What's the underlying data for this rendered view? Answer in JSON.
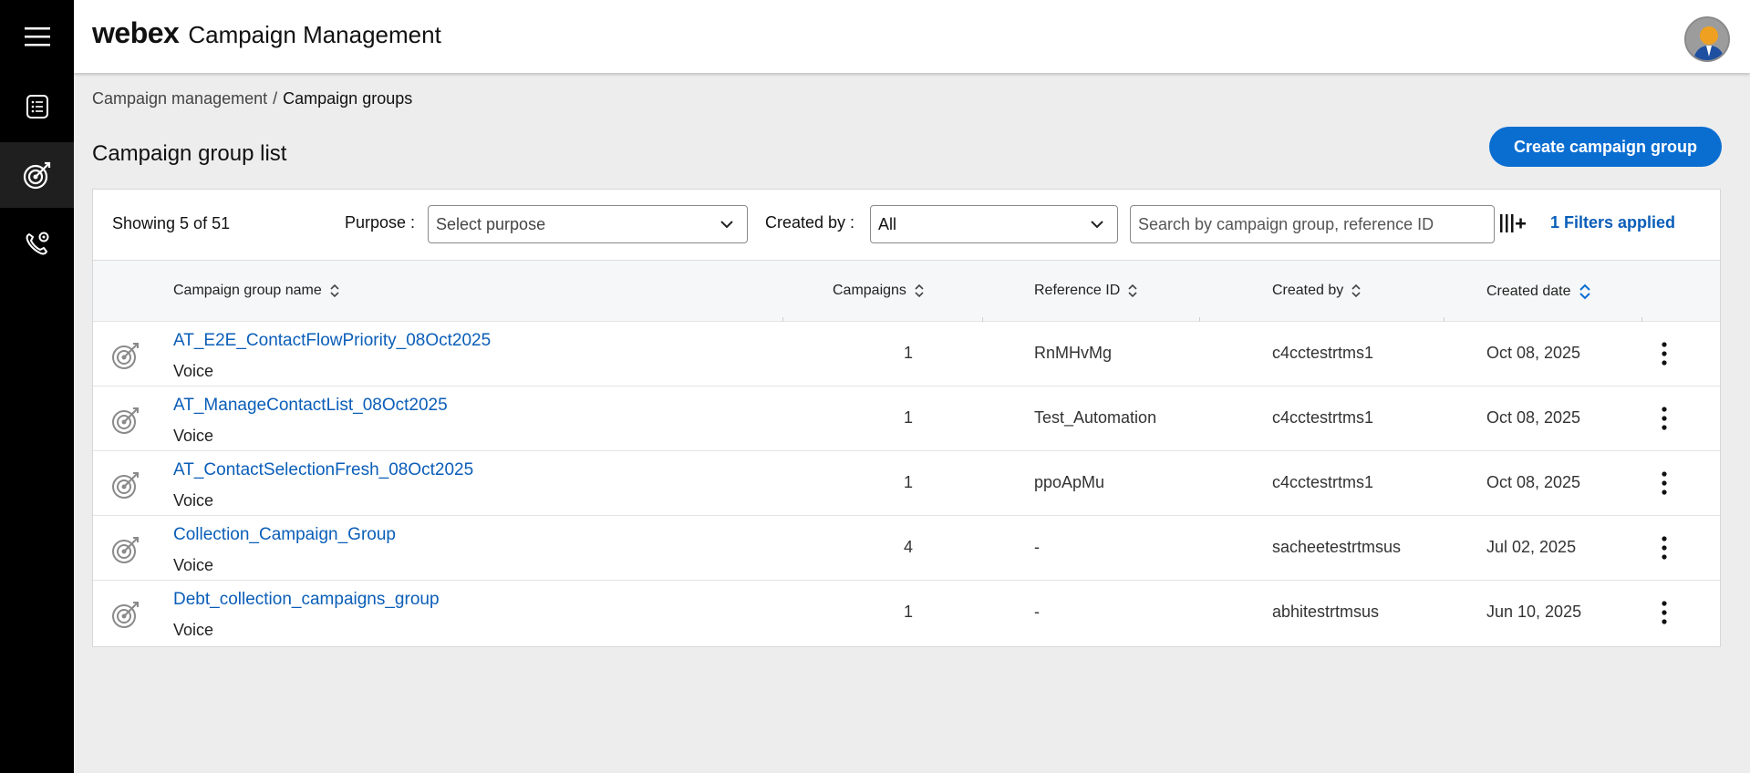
{
  "header": {
    "logo": "webex",
    "title": "Campaign Management"
  },
  "breadcrumb": {
    "parent": "Campaign management",
    "separator": "/",
    "current": "Campaign groups"
  },
  "page": {
    "title": "Campaign group list",
    "create_label": "Create campaign group"
  },
  "toolbar": {
    "showing": "Showing 5 of 51",
    "purpose_label": "Purpose :",
    "purpose_value": "Select purpose",
    "created_by_label": "Created by :",
    "created_by_value": "All",
    "search_placeholder": "Search by campaign group, reference ID",
    "filters_applied": "1 Filters applied"
  },
  "table": {
    "columns": {
      "name": "Campaign group name",
      "campaigns": "Campaigns",
      "reference": "Reference ID",
      "created_by": "Created by",
      "created_date": "Created date"
    },
    "rows": [
      {
        "name": "AT_E2E_ContactFlowPriority_08Oct2025",
        "type": "Voice",
        "campaigns": "1",
        "reference": "RnMHvMg",
        "created_by": "c4cctestrtms1",
        "created_date": "Oct 08, 2025"
      },
      {
        "name": "AT_ManageContactList_08Oct2025",
        "type": "Voice",
        "campaigns": "1",
        "reference": "Test_Automation",
        "created_by": "c4cctestrtms1",
        "created_date": "Oct 08, 2025"
      },
      {
        "name": "AT_ContactSelectionFresh_08Oct2025",
        "type": "Voice",
        "campaigns": "1",
        "reference": "ppoApMu",
        "created_by": "c4cctestrtms1",
        "created_date": "Oct 08, 2025"
      },
      {
        "name": "Collection_Campaign_Group",
        "type": "Voice",
        "campaigns": "4",
        "reference": "-",
        "created_by": "sacheetestrtmsus",
        "created_date": "Jul 02, 2025"
      },
      {
        "name": "Debt_collection_campaigns_group",
        "type": "Voice",
        "campaigns": "1",
        "reference": "-",
        "created_by": "abhitestrtmsus",
        "created_date": "Jun 10, 2025"
      }
    ]
  },
  "colors": {
    "accent": "#0a6ed1",
    "link": "#0a5eb8",
    "rail": "#000000"
  }
}
